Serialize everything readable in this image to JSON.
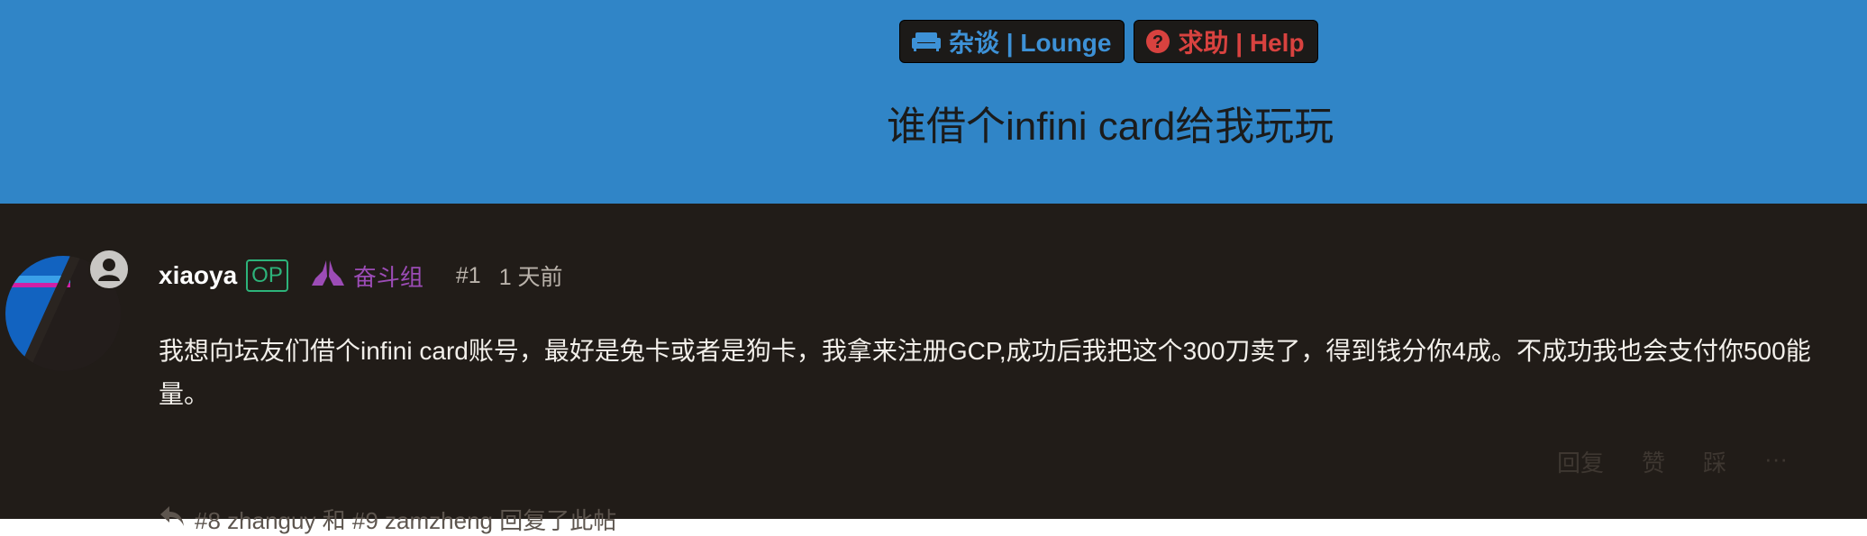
{
  "header": {
    "tags": [
      {
        "label": "杂谈 | Lounge",
        "icon": "couch-icon",
        "color": "#3d91d6"
      },
      {
        "label": "求助 | Help",
        "icon": "question-circle-icon",
        "color": "#d8423f"
      }
    ],
    "title": "谁借个infini card给我玩玩",
    "background": "#3085c7"
  },
  "post": {
    "username": "xiaoya",
    "op_badge": "OP",
    "group": "奋斗组",
    "post_number": "#1",
    "time": "1 天前",
    "body": "我想向坛友们借个infini card账号，最好是兔卡或者是狗卡，我拿来注册GCP,成功后我把这个300刀卖了，得到钱分你4成。不成功我也会支付你500能量。",
    "actions": [
      "回复",
      "赞",
      "踩",
      "···"
    ],
    "reply_summary": "#8 zhanguy 和 #9 zamzheng 回复了此帖"
  },
  "colors": {
    "main_background": "#211c18",
    "op": "#2db37a",
    "group": "#9c4cb6"
  }
}
